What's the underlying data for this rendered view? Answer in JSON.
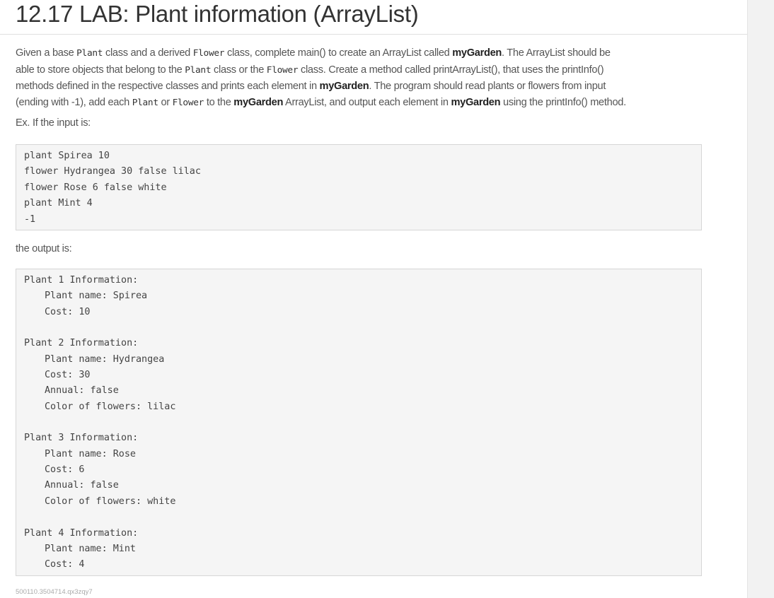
{
  "title": "12.17 LAB: Plant information (ArrayList)",
  "description": {
    "lines": [
      [
        {
          "t": "text",
          "v": "Given a base "
        },
        {
          "t": "code",
          "v": "Plant"
        },
        {
          "t": "text",
          "v": " class and a derived "
        },
        {
          "t": "code",
          "v": "Flower"
        },
        {
          "t": "text",
          "v": " class, complete main() to create an ArrayList called "
        },
        {
          "t": "bold",
          "v": "myGarden"
        },
        {
          "t": "text",
          "v": ". The ArrayList should be"
        }
      ],
      [
        {
          "t": "text",
          "v": "able to store objects that belong to the "
        },
        {
          "t": "code",
          "v": "Plant"
        },
        {
          "t": "text",
          "v": " class or the "
        },
        {
          "t": "code",
          "v": "Flower"
        },
        {
          "t": "text",
          "v": " class. Create a method called printArrayList(), that uses the printInfo()"
        }
      ],
      [
        {
          "t": "text",
          "v": "methods defined in the respective classes and prints each element in "
        },
        {
          "t": "bold",
          "v": "myGarden"
        },
        {
          "t": "text",
          "v": ". The program should read plants or flowers from input"
        }
      ],
      [
        {
          "t": "text",
          "v": "(ending with -1), add each "
        },
        {
          "t": "code",
          "v": "Plant"
        },
        {
          "t": "text",
          "v": " or "
        },
        {
          "t": "code",
          "v": "Flower"
        },
        {
          "t": "text",
          "v": " to the "
        },
        {
          "t": "bold",
          "v": "myGarden"
        },
        {
          "t": "text",
          "v": " ArrayList, and output each element in "
        },
        {
          "t": "bold",
          "v": "myGarden"
        },
        {
          "t": "text",
          "v": " using the printInfo() method."
        }
      ]
    ]
  },
  "input_label": "Ex. If the input is:",
  "input_lines": [
    "plant Spirea 10",
    "flower Hydrangea 30 false lilac",
    "flower Rose 6 false white",
    "plant Mint 4",
    "-1"
  ],
  "output_label": "the output is:",
  "output_lines": [
    {
      "text": "Plant 1 Information:",
      "indent": false
    },
    {
      "text": "Plant name: Spirea",
      "indent": true
    },
    {
      "text": "Cost: 10",
      "indent": true
    },
    {
      "text": "",
      "indent": false
    },
    {
      "text": "Plant 2 Information:",
      "indent": false
    },
    {
      "text": "Plant name: Hydrangea",
      "indent": true
    },
    {
      "text": "Cost: 30",
      "indent": true
    },
    {
      "text": "Annual: false",
      "indent": true
    },
    {
      "text": "Color of flowers: lilac",
      "indent": true
    },
    {
      "text": "",
      "indent": false
    },
    {
      "text": "Plant 3 Information:",
      "indent": false
    },
    {
      "text": "Plant name: Rose",
      "indent": true
    },
    {
      "text": "Cost: 6",
      "indent": true
    },
    {
      "text": "Annual: false",
      "indent": true
    },
    {
      "text": "Color of flowers: white",
      "indent": true
    },
    {
      "text": "",
      "indent": false
    },
    {
      "text": "Plant 4 Information:",
      "indent": false
    },
    {
      "text": "Plant name: Mint",
      "indent": true
    },
    {
      "text": "Cost: 4",
      "indent": true
    }
  ],
  "footer_id": "500110.3504714.qx3zqy7"
}
